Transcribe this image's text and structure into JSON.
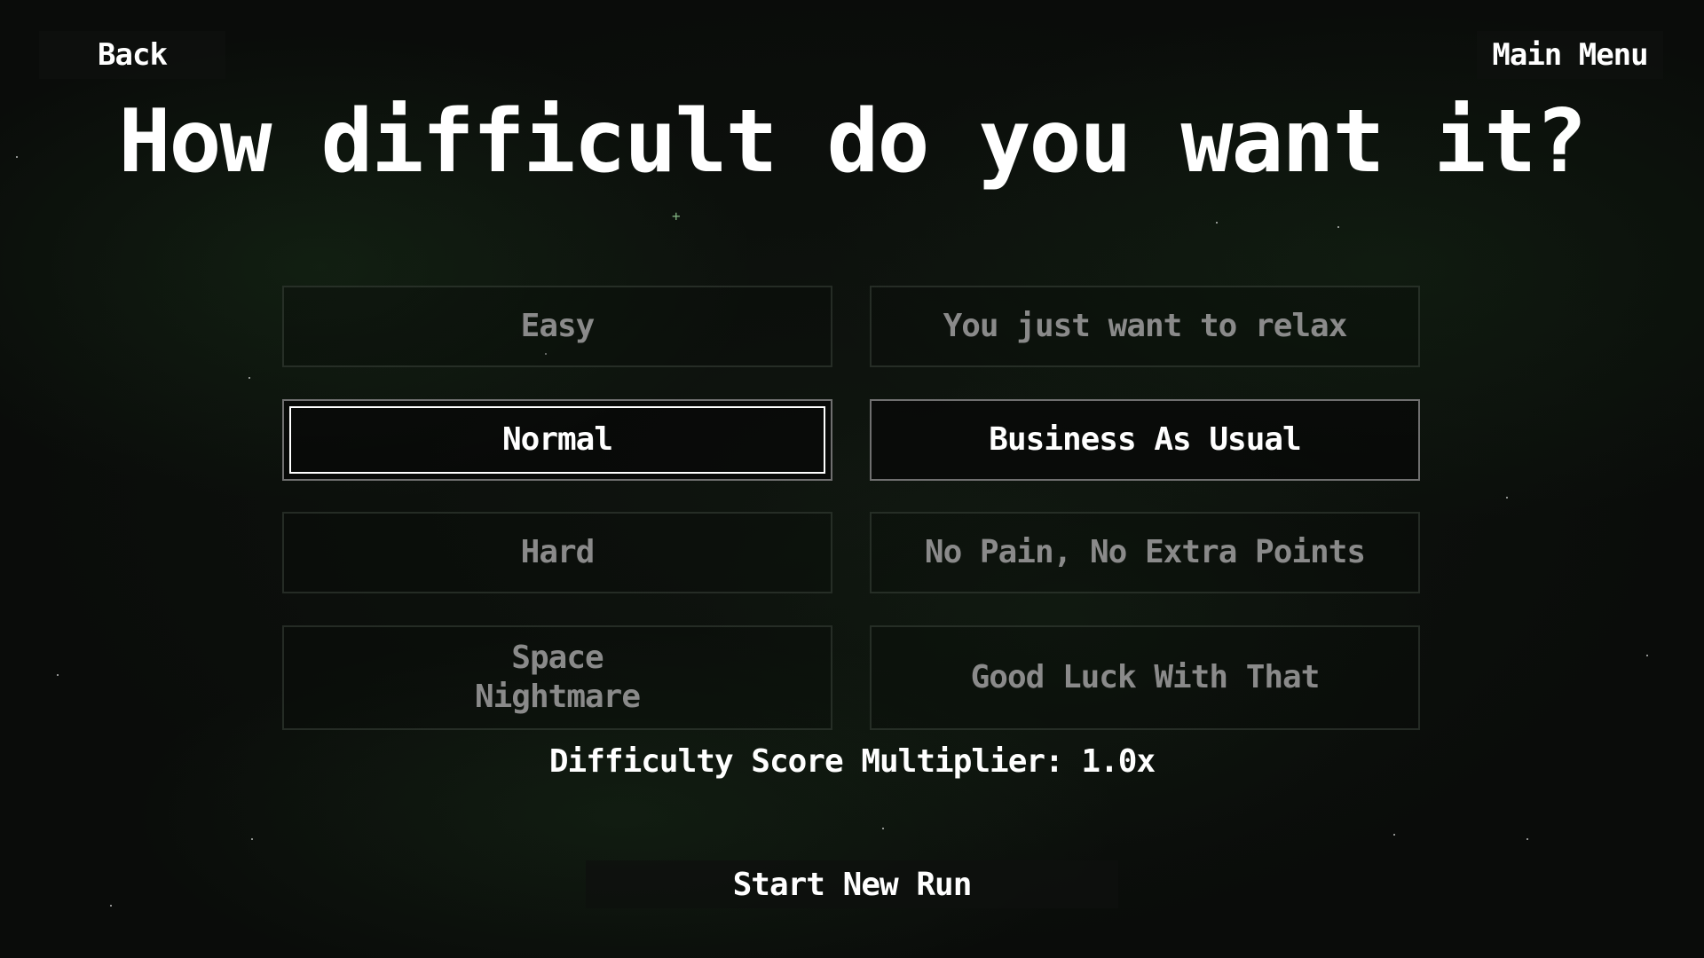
{
  "nav": {
    "back_label": "Back",
    "main_menu_label": "Main Menu"
  },
  "title": "How difficult do you want it?",
  "difficulties": [
    {
      "label": "Easy",
      "description": "You just want to relax",
      "selected": false
    },
    {
      "label": "Normal",
      "description": "Business As Usual",
      "selected": true
    },
    {
      "label": "Hard",
      "description": "No Pain, No Extra Points",
      "selected": false
    },
    {
      "label": "Space\nNightmare",
      "description": "Good Luck With That",
      "selected": false
    }
  ],
  "multiplier_text": "Difficulty Score Multiplier: 1.0x",
  "start_label": "Start New Run",
  "colors": {
    "selected_text": "#ffffff",
    "unselected_text": "#8a8a8a",
    "background": "#0a0c0a"
  }
}
